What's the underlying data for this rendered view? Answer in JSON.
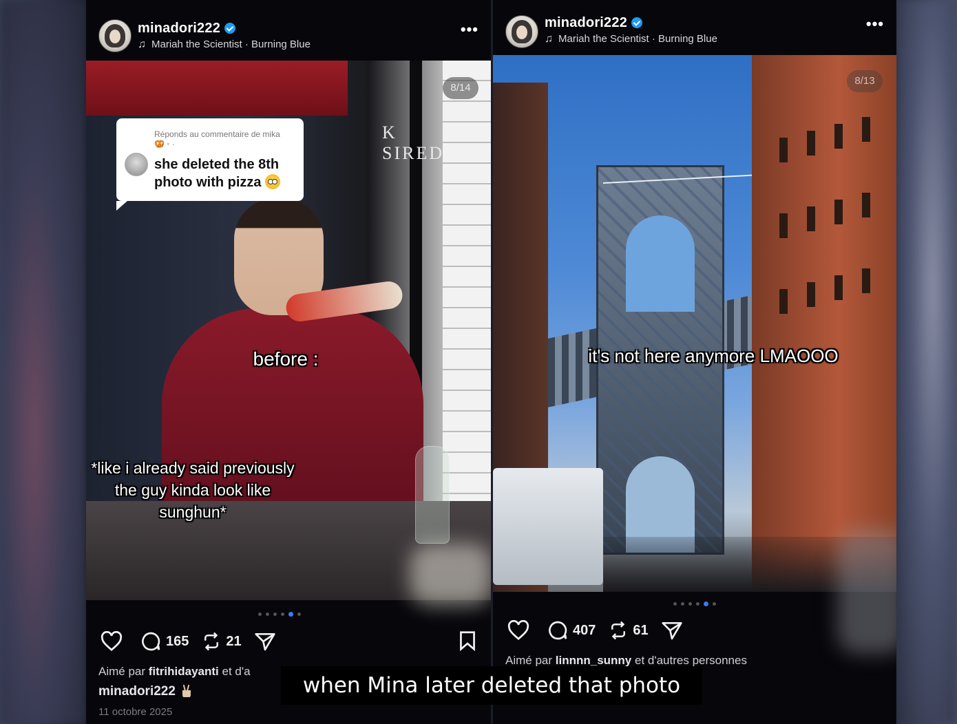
{
  "posts": [
    {
      "username": "minadori222",
      "music": "Mariah the Scientist · Burning Blue",
      "counter": "8/14",
      "reply": {
        "meta": "Réponds au commentaire de mika 🥨 ◦ ·",
        "text": "she deleted the 8th photo with pizza"
      },
      "sign_text": "K SIRED",
      "overlay_top": "before :",
      "overlay_bottom": "*like i already said previously the guy kinda look like sunghun*",
      "comments": "165",
      "reposts": "21",
      "liked_by_prefix": "Aimé par",
      "liked_by_user": "fitrihidayanti",
      "liked_by_suffix": "et d'a",
      "caption_user": "minadori222",
      "date": "11 octobre 2025"
    },
    {
      "username": "minadori222",
      "music": "Mariah the Scientist · Burning Blue",
      "counter": "8/13",
      "overlay_top": "it's not here anymore LMAOOO",
      "comments": "407",
      "reposts": "61",
      "liked_by_prefix": "Aimé par",
      "liked_by_user": "linnnn_sunny",
      "liked_by_suffix": "et d'autres personnes"
    }
  ],
  "subtitle": "when Mina later deleted that photo",
  "colors": {
    "verified": "#1d9bf0",
    "active_dot": "#3b7bf6",
    "background": "#07070b"
  },
  "icons": [
    "music-note-icon",
    "verified-icon",
    "more-icon",
    "heart-icon",
    "comment-icon",
    "repost-icon",
    "share-icon",
    "bookmark-icon",
    "peace-emoji-icon",
    "flushed-emoji-icon"
  ]
}
